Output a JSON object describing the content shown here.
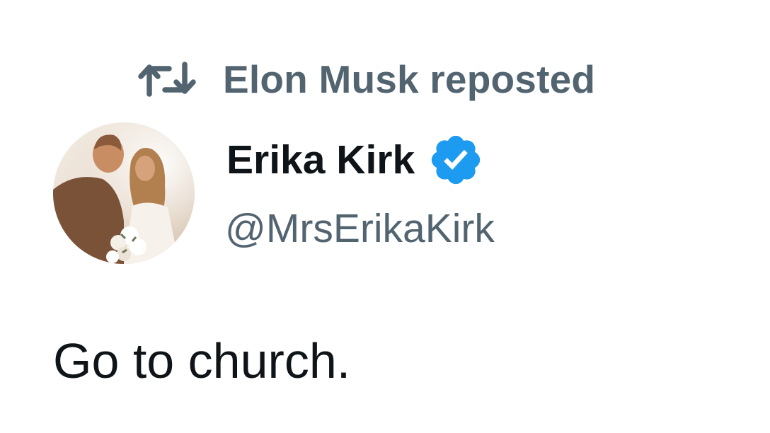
{
  "repost_header": {
    "icon": "repost-icon",
    "text": "Elon Musk reposted"
  },
  "author": {
    "display_name": "Erika Kirk",
    "handle": "@MrsErikaKirk",
    "verified_icon": "verified-badge-icon",
    "verified_color": "#1d9bf0"
  },
  "tweet": {
    "text": "Go to church."
  },
  "colors": {
    "secondary_text": "#536471",
    "primary_text": "#0f1419",
    "background": "#ffffff"
  }
}
